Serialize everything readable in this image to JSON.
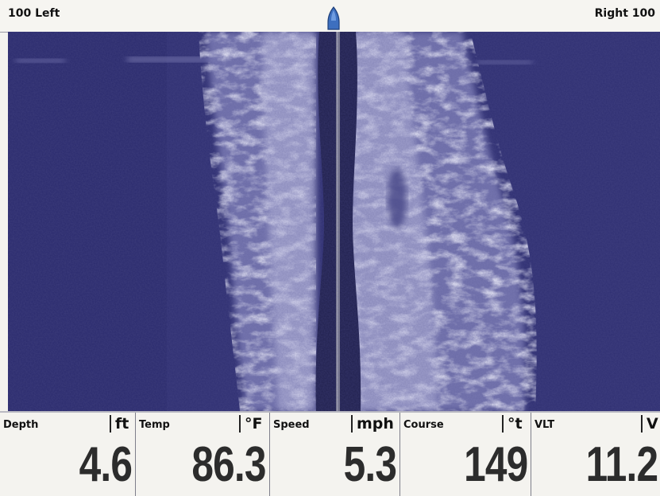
{
  "range": {
    "left_label": "100 Left",
    "right_label": "Right 100"
  },
  "sonar": {
    "mode": "side-imaging",
    "colors": {
      "water": "#2f2f72",
      "returns": "#dcdcf0",
      "keel": "#20204e",
      "centerline": "#7a7a8c",
      "boat_marker": "#3d6fbf"
    }
  },
  "readouts": [
    {
      "label": "Depth",
      "unit": "ft",
      "value": "4.6"
    },
    {
      "label": "Temp",
      "unit": "°F",
      "value": "86.3"
    },
    {
      "label": "Speed",
      "unit": "mph",
      "value": "5.3"
    },
    {
      "label": "Course",
      "unit": "°t",
      "value": "149"
    },
    {
      "label": "VLT",
      "unit": "V",
      "value": "11.2"
    }
  ]
}
